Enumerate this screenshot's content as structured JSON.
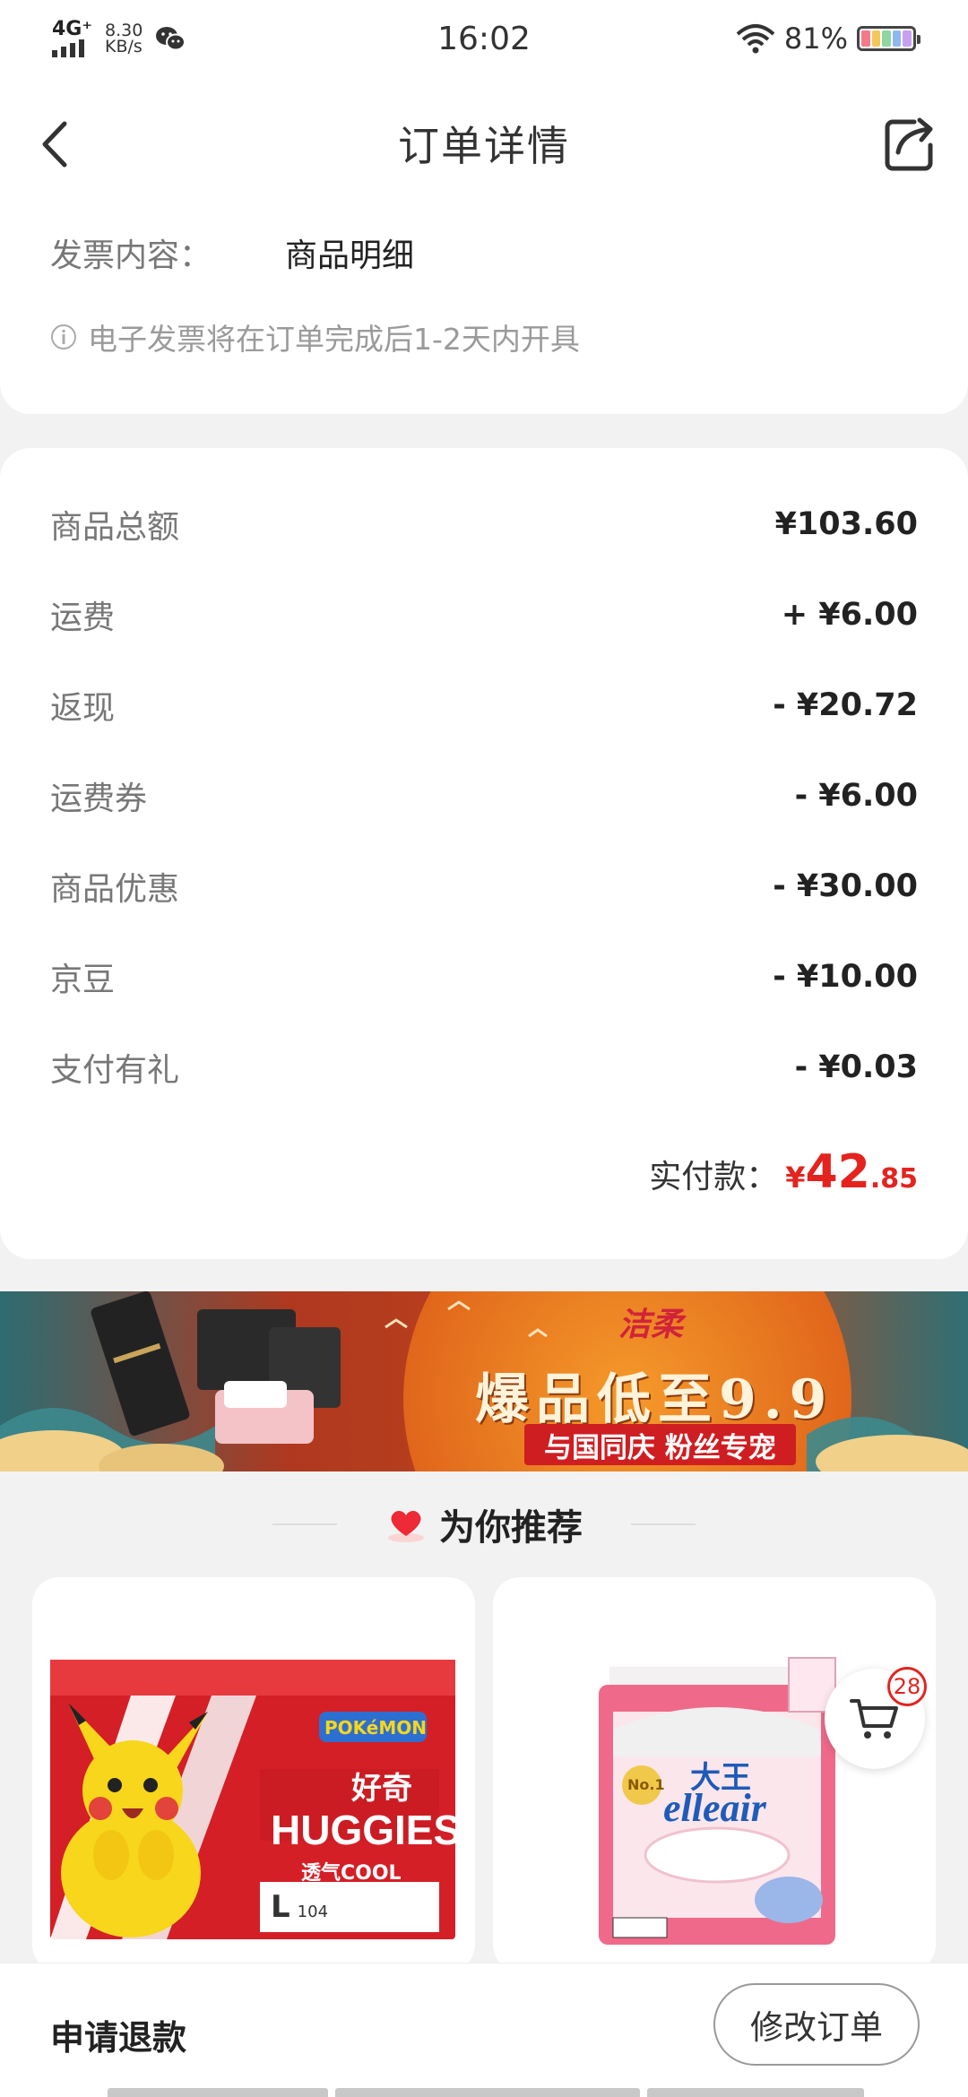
{
  "status_bar": {
    "network": "4G⁺",
    "speed_value": "8.30",
    "speed_unit": "KB/s",
    "time": "16:02",
    "battery": "81%"
  },
  "header": {
    "title": "订单详情"
  },
  "invoice": {
    "label": "发票内容：",
    "value": "商品明细",
    "note": "电子发票将在订单完成后1-2天内开具"
  },
  "price_rows": [
    {
      "label": "商品总额",
      "value": "¥103.60"
    },
    {
      "label": "运费",
      "value": "+ ¥6.00"
    },
    {
      "label": "返现",
      "value": "- ¥20.72"
    },
    {
      "label": "运费券",
      "value": "- ¥6.00"
    },
    {
      "label": "商品优惠",
      "value": "- ¥30.00"
    },
    {
      "label": "京豆",
      "value": "- ¥10.00"
    },
    {
      "label": "支付有礼",
      "value": "- ¥0.03"
    }
  ],
  "total": {
    "label": "实付款：",
    "currency": "¥",
    "integer": "42",
    "decimal": ".85"
  },
  "banner": {
    "brand": "洁柔",
    "headline": "爆品低至9.9",
    "sub": "与国同庆 粉丝专宠"
  },
  "recommend": {
    "title": "为你推荐"
  },
  "products": [
    {
      "brand_main": "HUGGIES",
      "brand_cn": "好奇",
      "tagline": "透气COOL",
      "partner": "POKéMON",
      "size": "L",
      "count": "104"
    },
    {
      "brand_cn": "大王",
      "brand_main": "elleair",
      "badge": "No.1"
    }
  ],
  "cart": {
    "badge_count": "28"
  },
  "bottom": {
    "refund": "申请退款",
    "modify": "修改订单"
  },
  "colors": {
    "accent": "#e4231f",
    "background": "#f2f2f2"
  }
}
